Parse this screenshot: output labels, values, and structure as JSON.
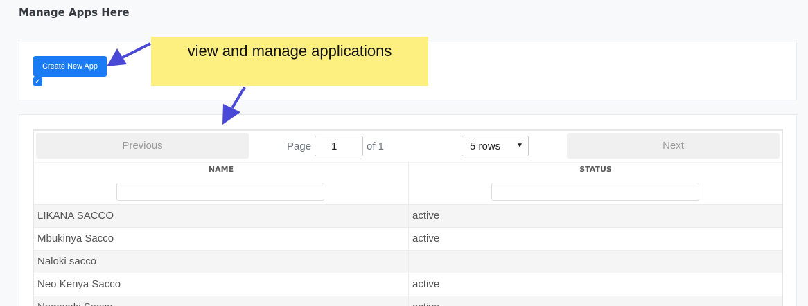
{
  "page": {
    "title": "Manage Apps Here"
  },
  "toolbar": {
    "create_label": "Create New App",
    "checkbox_checked": true
  },
  "callout": {
    "text": "view and manage applications"
  },
  "pager": {
    "previous_label": "Previous",
    "next_label": "Next",
    "page_label": "Page",
    "page_value": "1",
    "of_label": "of 1",
    "rows_value": "5 rows"
  },
  "table": {
    "columns": [
      "NAME",
      "STATUS"
    ],
    "rows": [
      {
        "name": "LIKANA SACCO",
        "status": "active"
      },
      {
        "name": "Mbukinya Sacco",
        "status": "active"
      },
      {
        "name": "Naloki sacco",
        "status": ""
      },
      {
        "name": "Neo Kenya Sacco",
        "status": "active"
      },
      {
        "name": "Nagasaki Sacco",
        "status": "active"
      }
    ]
  },
  "colors": {
    "primary": "#1a7cf4",
    "callout": "#fdef80",
    "arrow": "#4a48d6"
  }
}
